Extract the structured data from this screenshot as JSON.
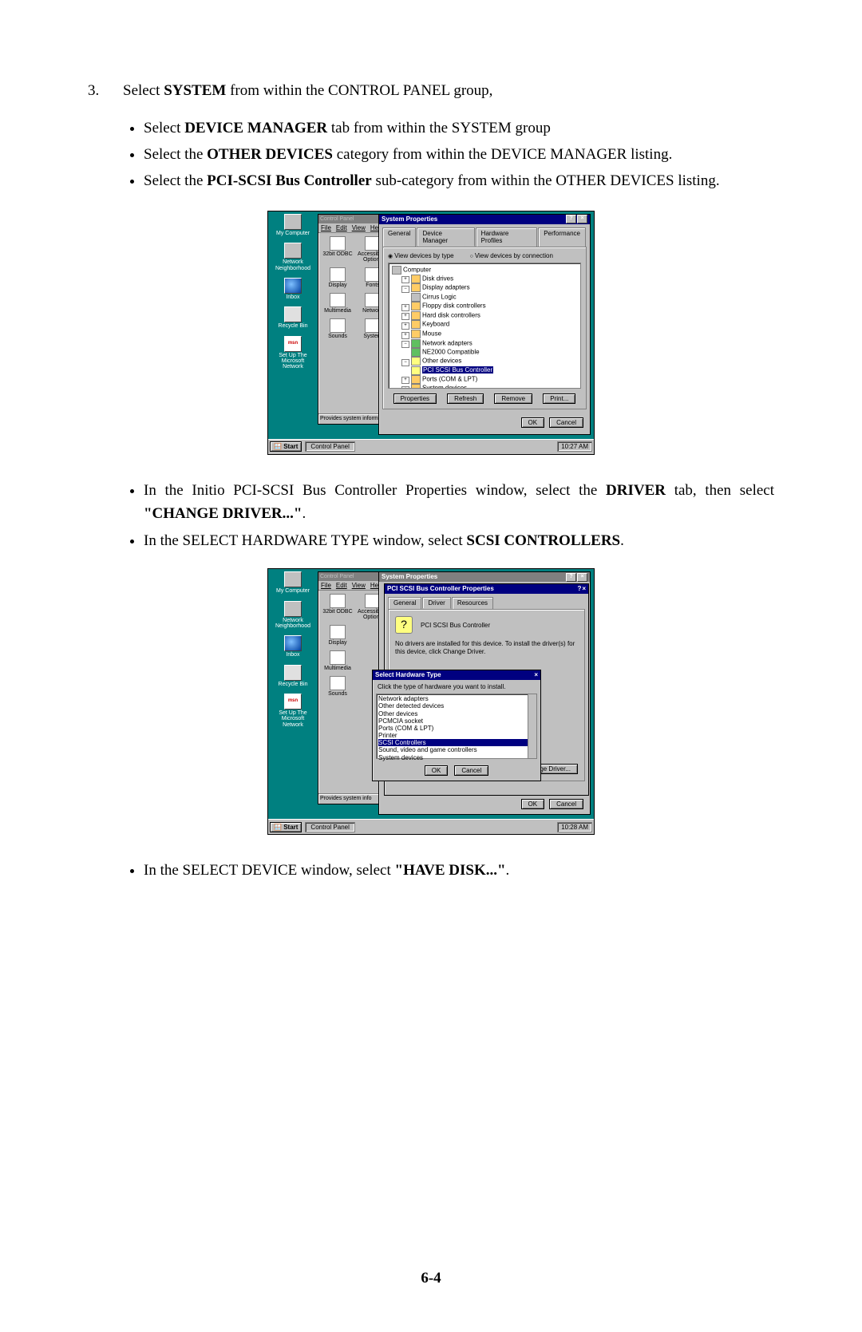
{
  "step": {
    "num": "3.",
    "text_a": "Select ",
    "text_b": "SYSTEM",
    "text_c": " from within the CONTROL PANEL group,"
  },
  "b1": [
    {
      "a": "Select ",
      "b": "DEVICE MANAGER",
      "c": " tab from within the SYSTEM group"
    },
    {
      "a": "Select the ",
      "b": "OTHER DEVICES",
      "c": " category from within the DEVICE MANAGER listing."
    },
    {
      "a": "Select the ",
      "b": "PCI-SCSI Bus Controller",
      "c": " sub-category from within the OTHER DEVICES listing."
    }
  ],
  "b2": [
    {
      "a": "In the Initio PCI-SCSI Bus Controller Properties window, select  the ",
      "b": "DRIVER",
      "c": " tab, then select ",
      "d": "\"CHANGE DRIVER...\"",
      "e": "."
    },
    {
      "a": "In the SELECT HARDWARE TYPE window, select ",
      "b": "SCSI CONTROLLERS",
      "c": "."
    }
  ],
  "b3": [
    {
      "a": "In the SELECT DEVICE window, select ",
      "b": "\"HAVE DISK...\"",
      "c": "."
    }
  ],
  "desktop_icons": [
    "My Computer",
    "Network Neighborhood",
    "Inbox",
    "Recycle Bin",
    "Set Up The Microsoft Network"
  ],
  "cp": {
    "title": "Control Panel",
    "menu": [
      "File",
      "Edit",
      "View",
      "Help"
    ],
    "icons": [
      "32bit ODBC",
      "Accessibility Options",
      "Display",
      "Fonts",
      "Multimedia",
      "Network",
      "Sounds",
      "System"
    ],
    "status1": "Provides system informa",
    "status2": "Provides system info"
  },
  "sys": {
    "title": "System Properties",
    "tabs": [
      "General",
      "Device Manager",
      "Hardware Profiles",
      "Performance"
    ],
    "radio1": "View devices by type",
    "radio2": "View devices by connection",
    "tree": [
      {
        "lv": 1,
        "pm": "",
        "ic": "icg",
        "t": "Computer"
      },
      {
        "lv": 2,
        "pm": "+",
        "ic": "ic",
        "t": "Disk drives"
      },
      {
        "lv": 2,
        "pm": "−",
        "ic": "ic",
        "t": "Display adapters"
      },
      {
        "lv": 3,
        "pm": "",
        "ic": "icg",
        "t": "Cirrus Logic"
      },
      {
        "lv": 2,
        "pm": "+",
        "ic": "ic",
        "t": "Floppy disk controllers"
      },
      {
        "lv": 2,
        "pm": "+",
        "ic": "ic",
        "t": "Hard disk controllers"
      },
      {
        "lv": 2,
        "pm": "+",
        "ic": "ic",
        "t": "Keyboard"
      },
      {
        "lv": 2,
        "pm": "+",
        "ic": "ic",
        "t": "Mouse"
      },
      {
        "lv": 2,
        "pm": "−",
        "ic": "icn",
        "t": "Network adapters"
      },
      {
        "lv": 3,
        "pm": "",
        "ic": "icn",
        "t": "NE2000 Compatible"
      },
      {
        "lv": 2,
        "pm": "−",
        "ic": "icq",
        "t": "Other devices"
      },
      {
        "lv": 3,
        "pm": "",
        "ic": "icq",
        "t": "PCI SCSI Bus Controller",
        "sel": true
      },
      {
        "lv": 2,
        "pm": "+",
        "ic": "ic",
        "t": "Ports (COM & LPT)"
      },
      {
        "lv": 2,
        "pm": "+",
        "ic": "ic",
        "t": "System devices"
      }
    ],
    "btns": [
      "Properties",
      "Refresh",
      "Remove",
      "Print..."
    ],
    "ok": "OK",
    "cancel": "Cancel"
  },
  "taskbar": {
    "start": "Start",
    "task": "Control Panel",
    "time1": "10:27 AM",
    "time2": "10:28 AM"
  },
  "prop": {
    "title": "PCI SCSI Bus Controller Properties",
    "tabs": [
      "General",
      "Driver",
      "Resources"
    ],
    "name": "PCI SCSI Bus Controller",
    "msg": "No drivers are installed for this device. To install the driver(s) for this device, click Change Driver.",
    "change": "Change Driver..."
  },
  "sel": {
    "title": "Select Hardware Type",
    "prompt": "Click the type of hardware you want to install.",
    "items": [
      "Network adapters",
      "Other detected devices",
      "Other devices",
      "PCMCIA socket",
      "Ports (COM & LPT)",
      "Printer",
      "SCSI Controllers",
      "Sound, video and game controllers",
      "System devices"
    ],
    "sel_index": 6,
    "ok": "OK",
    "cancel": "Cancel"
  },
  "pagenum": "6-4"
}
